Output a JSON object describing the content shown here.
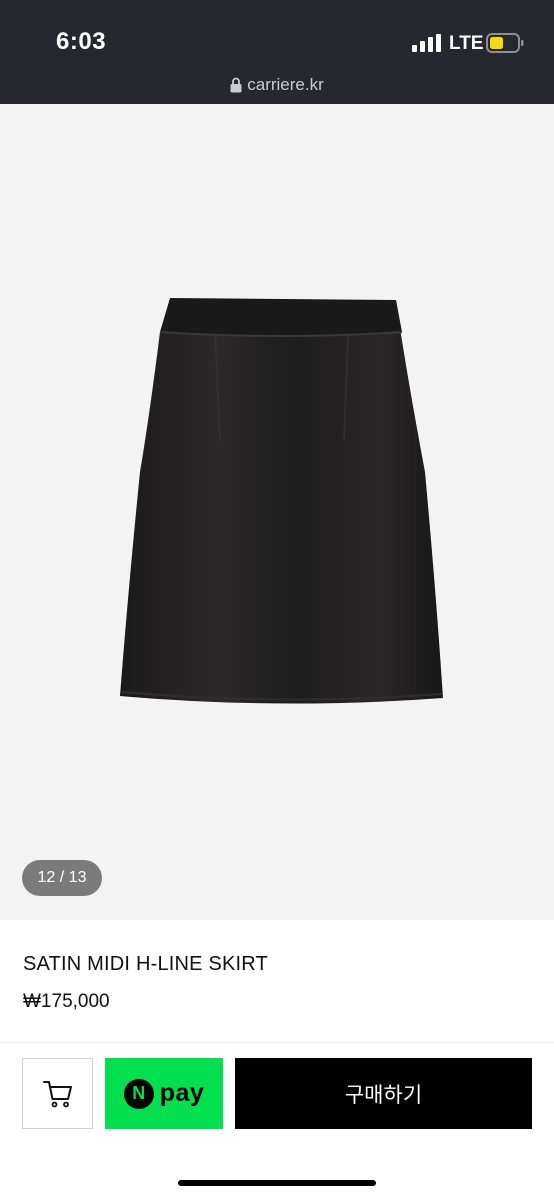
{
  "status_bar": {
    "time": "6:03",
    "network": "LTE",
    "signal_icon": "signal-bars-icon",
    "battery_icon": "battery-low-icon",
    "battery_color": "#f5d90a"
  },
  "address_bar": {
    "lock_icon": "lock-icon",
    "url": "carriere.kr"
  },
  "gallery": {
    "image": "black satin midi skirt",
    "counter": "12 / 13"
  },
  "product": {
    "title": "SATIN MIDI H-LINE SKIRT",
    "price": "₩175,000"
  },
  "actions": {
    "cart_icon": "cart-icon",
    "npay_logo_letter": "N",
    "npay_label": "pay",
    "npay_color": "#03e04f",
    "buy_label": "구매하기"
  }
}
